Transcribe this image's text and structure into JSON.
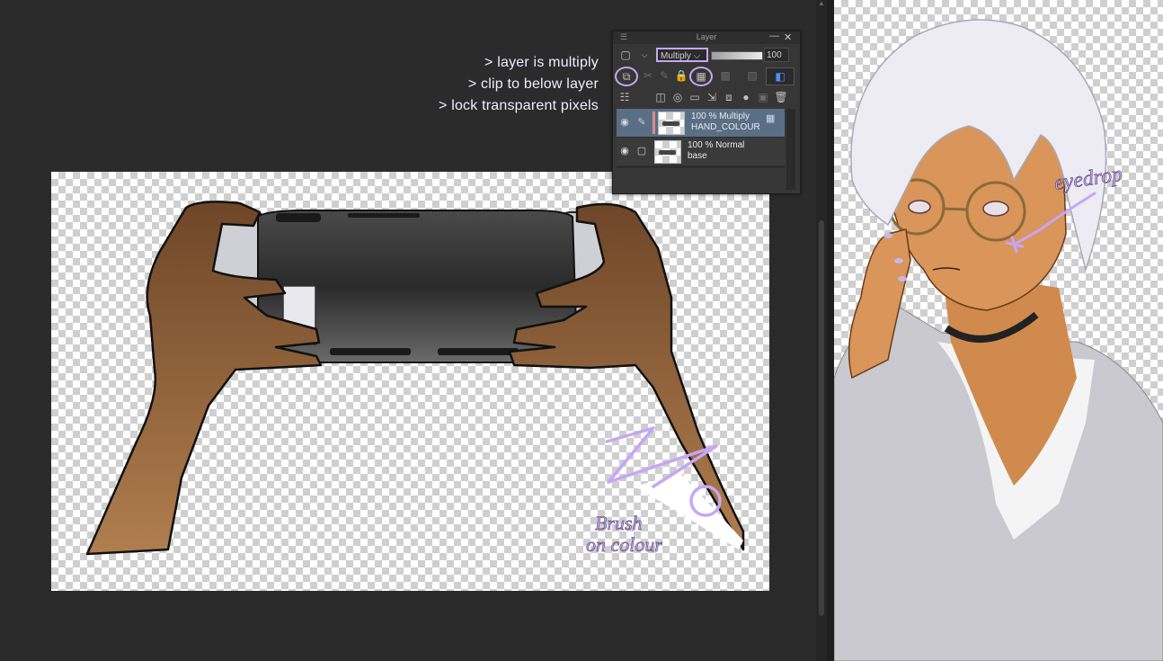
{
  "annotations": {
    "note1": "> layer is multiply",
    "note2": "> clip to below layer",
    "note3": "> lock transparent pixels",
    "brush_note_line1": "Brush",
    "brush_note_line2": "on colour",
    "eyedrop_note": "eyedrop",
    "annotation_color": "#c7a6f5"
  },
  "layer_panel": {
    "title": "Layer",
    "minimize_glyph": "—",
    "close_glyph": "✕",
    "blend_mode": "Multiply",
    "opacity": "100",
    "layers": [
      {
        "line1": "100 % Multiply",
        "line2": "HAND_COLOUR",
        "selected": true,
        "clipped": true
      },
      {
        "line1": "100 % Normal",
        "line2": "base",
        "selected": false,
        "clipped": false
      }
    ],
    "icons": {
      "clip": "clip-to-below-icon",
      "lock_transparent": "lock-transparent-icon",
      "reference": "reference-layer-icon",
      "lock": "lock-icon",
      "draft": "draft-layer-icon",
      "mask": "mask-icon",
      "color_swatch": "layer-color-icon",
      "new_raster": "new-raster-layer-icon",
      "new_vector": "new-vector-layer-icon",
      "new_folder": "new-folder-icon",
      "transfer": "transfer-down-icon",
      "merge": "merge-down-icon",
      "apply_mask": "apply-mask-icon",
      "delete": "trash-icon"
    }
  },
  "colors": {
    "workspace_bg": "#2b2b2b",
    "panel_bg": "#363636",
    "selected_layer": "#5a6f86",
    "skin": "#8a5a35"
  }
}
